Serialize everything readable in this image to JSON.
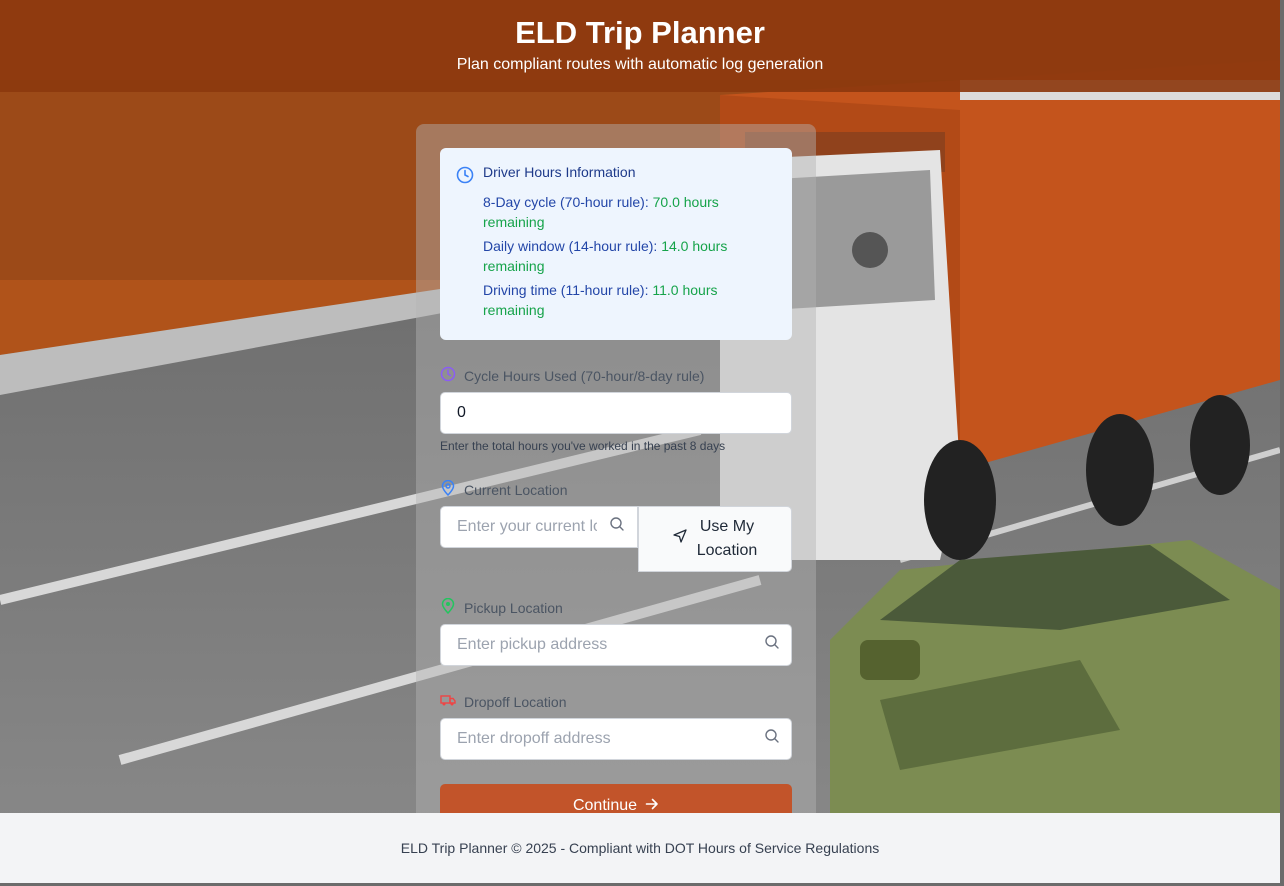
{
  "header": {
    "title": "ELD Trip Planner",
    "subtitle": "Plan compliant routes with automatic log generation"
  },
  "info": {
    "title": "Driver Hours Information",
    "icon": "clock-icon",
    "lines": [
      {
        "label": "8-Day cycle (70-hour rule): ",
        "value": "70.0 hours",
        "suffix": "remaining"
      },
      {
        "label": "Daily window (14-hour rule): ",
        "value": "14.0 hours",
        "suffix": "remaining"
      },
      {
        "label": "Driving time (11-hour rule): ",
        "value": "11.0 hours",
        "suffix": "remaining"
      }
    ]
  },
  "form": {
    "cycle": {
      "label": "Cycle Hours Used (70-hour/8-day rule)",
      "value": "0",
      "hint": "Enter the total hours you've worked in the past 8 days"
    },
    "current": {
      "label": "Current Location",
      "placeholder": "Enter your current location",
      "button_line1": "Use My",
      "button_line2": "Location"
    },
    "pickup": {
      "label": "Pickup Location",
      "placeholder": "Enter pickup address"
    },
    "dropoff": {
      "label": "Dropoff Location",
      "placeholder": "Enter dropoff address"
    },
    "continue_label": "Continue"
  },
  "footer": {
    "text": "ELD Trip Planner © 2025 - Compliant with DOT Hours of Service Regulations"
  },
  "colors": {
    "header_bg": "#8c380e",
    "accent": "#c2542a",
    "info_bg": "#eef5fe",
    "info_value": "#16a34a",
    "info_label": "#2346a8"
  }
}
